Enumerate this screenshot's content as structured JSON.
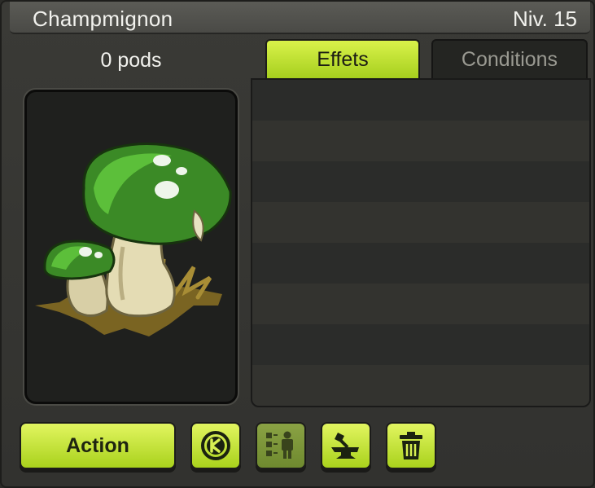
{
  "window": {
    "title": "Champmignon",
    "level": "Niv. 15"
  },
  "inventory": {
    "pods": "0 pods"
  },
  "tabs": [
    {
      "label": "Effets",
      "active": true
    },
    {
      "label": "Conditions",
      "active": false
    }
  ],
  "effects": {
    "rows": [
      "",
      "",
      "",
      "",
      "",
      "",
      "",
      ""
    ]
  },
  "actions": {
    "action_label": "Action",
    "buttons": [
      {
        "icon": "kama-icon",
        "enabled": true
      },
      {
        "icon": "equip-character-icon",
        "enabled": false
      },
      {
        "icon": "craft-anvil-icon",
        "enabled": true
      },
      {
        "icon": "trash-icon",
        "enabled": true
      }
    ]
  },
  "colors": {
    "accent": "#c6e835",
    "background": "#32322f",
    "title_text": "#f2f2ee"
  }
}
